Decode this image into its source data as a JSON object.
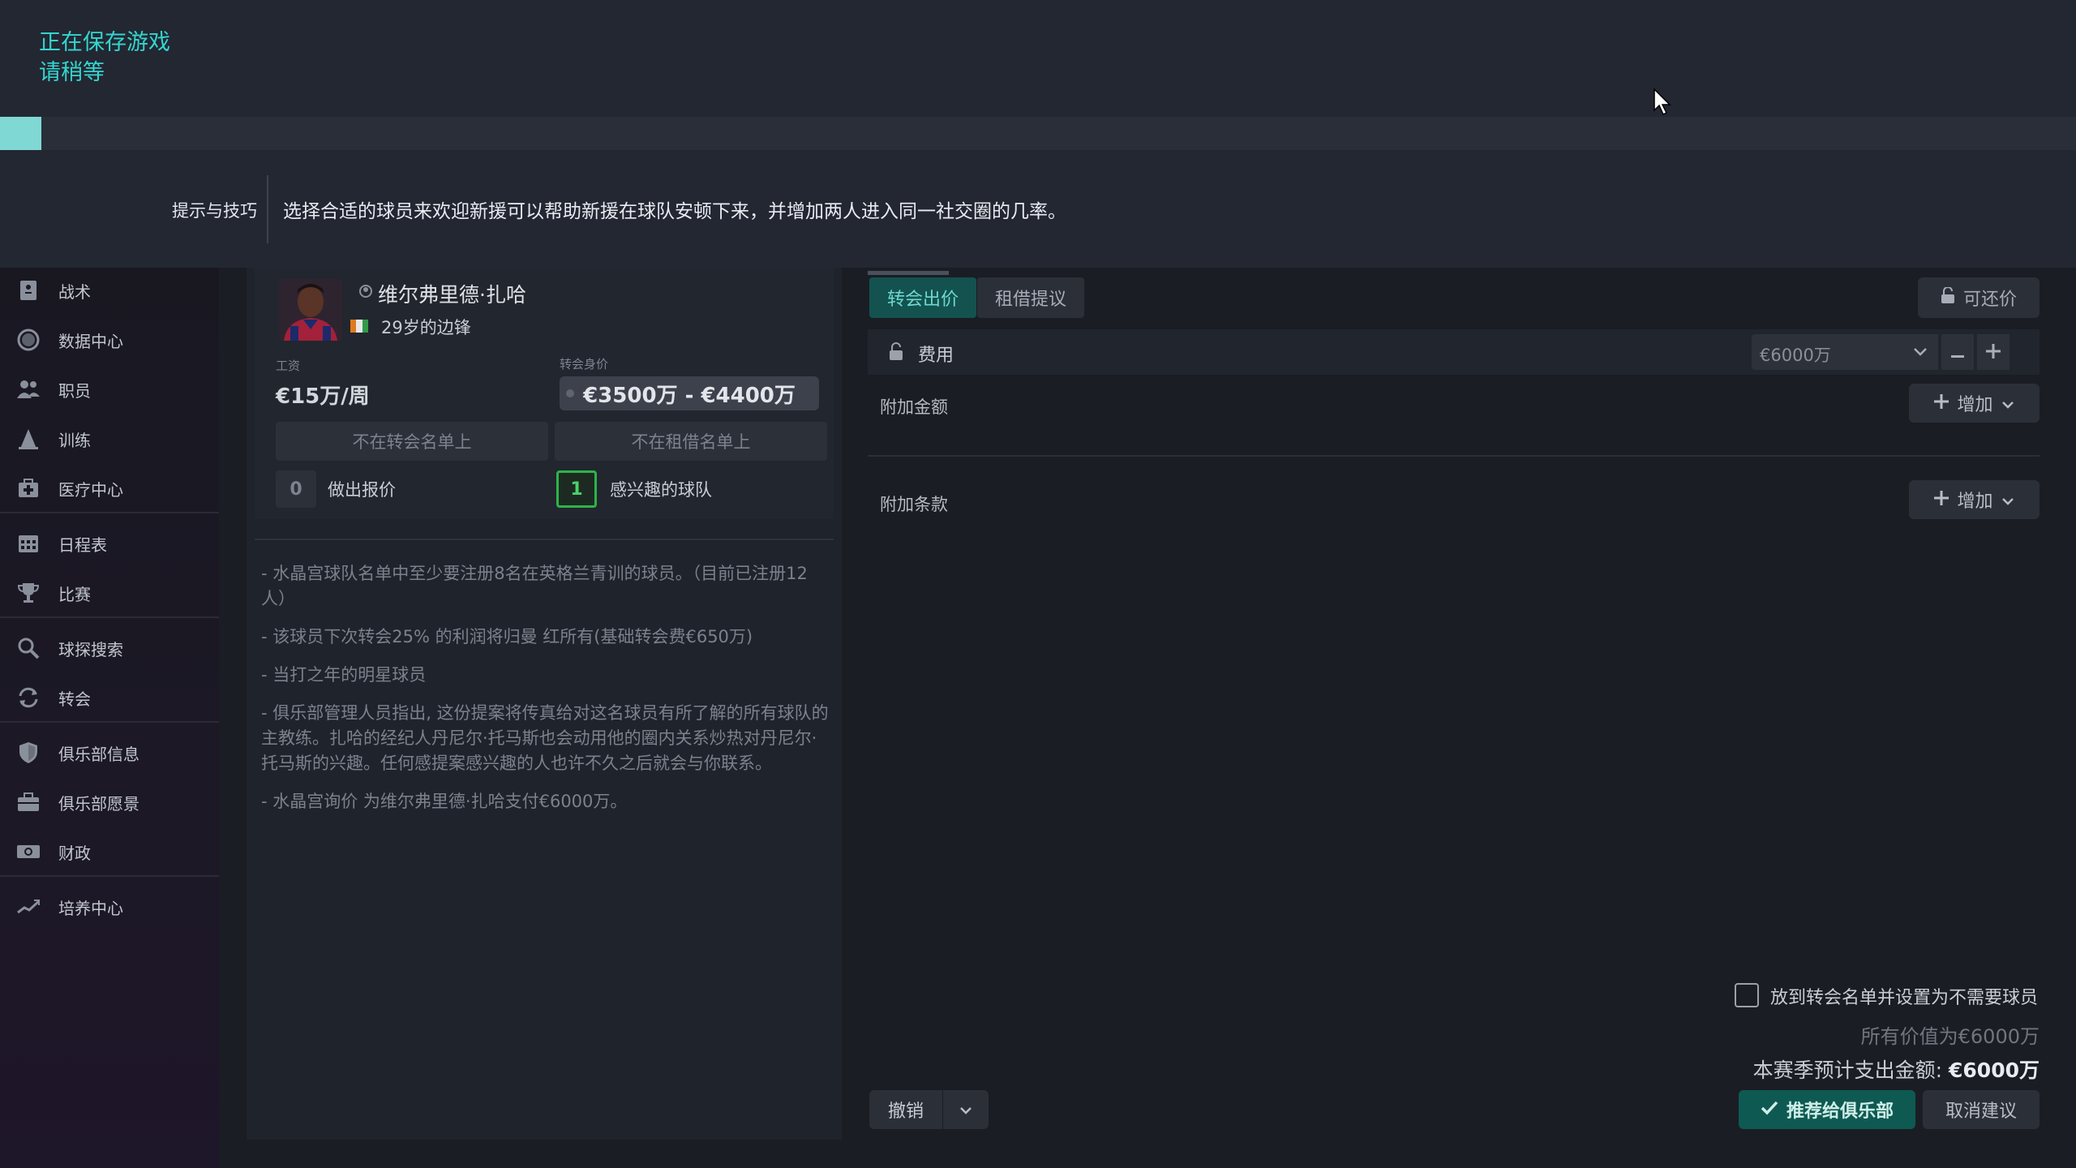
{
  "banner": {
    "saving_line1": "正在保存游戏",
    "saving_line2": "请稍等",
    "progress_fraction": 0.02,
    "tips_label": "提示与技巧",
    "tips_text": "选择合适的球员来欢迎新援可以帮助新援在球队安顿下来，并增加两人进入同一社交圈的几率。"
  },
  "sidebar": {
    "items": [
      {
        "label": "战术",
        "icon": "tactics-icon"
      },
      {
        "label": "数据中心",
        "icon": "data-hub-icon"
      },
      {
        "label": "职员",
        "icon": "staff-icon"
      },
      {
        "label": "训练",
        "icon": "training-icon"
      },
      {
        "label": "医疗中心",
        "icon": "medical-icon"
      },
      {
        "label": "日程表",
        "icon": "calendar-icon"
      },
      {
        "label": "比赛",
        "icon": "trophy-icon"
      },
      {
        "label": "球探搜索",
        "icon": "search-icon"
      },
      {
        "label": "转会",
        "icon": "transfer-icon"
      },
      {
        "label": "俱乐部信息",
        "icon": "shield-icon"
      },
      {
        "label": "俱乐部愿景",
        "icon": "briefcase-icon"
      },
      {
        "label": "财政",
        "icon": "finance-icon"
      },
      {
        "label": "培养中心",
        "icon": "development-icon"
      }
    ]
  },
  "player": {
    "name": "维尔弗里德·扎哈",
    "description": "29岁的边锋",
    "wage_label": "工资",
    "wage_value": "€15万/周",
    "value_label": "转会身价",
    "value_range": "€3500万 - €4400万",
    "transfer_list_status": "不在转会名单上",
    "loan_list_status": "不在租借名单上",
    "offers_count": "0",
    "offers_label": "做出报价",
    "interested_count": "1",
    "interested_label": "感兴趣的球队"
  },
  "notes": [
    "- 水晶宫球队名单中至少要注册8名在英格兰青训的球员。（目前已注册12人）",
    "- 该球员下次转会25% 的利润将归曼 红所有(基础转会费€650万)",
    "- 当打之年的明星球员",
    "- 俱乐部管理人员指出, 这份提案将传真给对这名球员有所了解的所有球队的主教练。扎哈的经纪人丹尼尔·托马斯也会动用他的圈内关系炒热对丹尼尔·托马斯的兴趣。任何感提案感兴趣的人也许不久之后就会与你联系。",
    "- 水晶宫询价 为维尔弗里德·扎哈支付€6000万。"
  ],
  "offer": {
    "tab_transfer": "转会出价",
    "tab_loan": "租借提议",
    "negotiable": "可还价",
    "fee_label": "费用",
    "fee_value": "€6000万",
    "add_amount_label": "附加金额",
    "add_clause_label": "附加条款",
    "add_button": "增加",
    "checkbox_label": "放到转会名单并设置为不需要球员",
    "all_value": "所有价值为€6000万",
    "season_spend_prefix": "本赛季预计支出金额: ",
    "season_spend_value": "€6000万",
    "undo": "撤销",
    "recommend": "推荐给俱乐部",
    "cancel": "取消建议"
  },
  "colors": {
    "accent": "#33d6cf",
    "recommend_bg": "#0e5a52",
    "interested_border": "#2db34a"
  }
}
